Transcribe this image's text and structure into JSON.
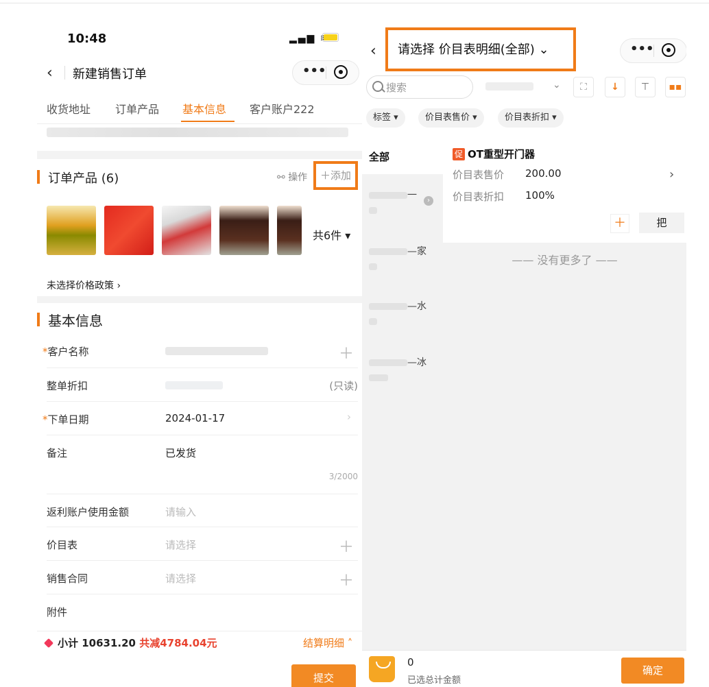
{
  "left": {
    "status": {
      "time": "10:48"
    },
    "nav": {
      "title": "新建销售订单"
    },
    "tabs": [
      "收货地址",
      "订单产品",
      "基本信息",
      "客户账户222"
    ],
    "products": {
      "title": "订单产品 (6)",
      "op_label": "操作",
      "add_label": "添加",
      "count_label": "共6件",
      "policy": "未选择价格政策 ›"
    },
    "basic": {
      "title": "基本信息",
      "fields": {
        "customer": "客户名称",
        "discount": "整单折扣",
        "discount_readonly": "(只读)",
        "date": "下单日期",
        "date_value": "2024-01-17",
        "note": "备注",
        "note_value": "已发货",
        "note_counter": "3/2000",
        "rebate": "返利账户使用金额",
        "rebate_placeholder": "请输入",
        "pricelist": "价目表",
        "pricelist_placeholder": "请选择",
        "contract": "销售合同",
        "contract_placeholder": "请选择",
        "attachment": "附件"
      }
    },
    "bottom": {
      "subtotal": "小计 10631.20",
      "discount_total": "共减4784.04元",
      "settle": "结算明细",
      "submit": "提交"
    }
  },
  "right": {
    "title": "请选择 价目表明细(全部)",
    "search_placeholder": "搜索",
    "chips": [
      "标签",
      "价目表售价",
      "价目表折扣"
    ],
    "sidebar": {
      "all": "全部",
      "items": [
        "一",
        "—家",
        "—水",
        "—冰"
      ]
    },
    "product": {
      "promo": "促",
      "name": "OT重型开门器",
      "price_label": "价目表售价",
      "price_value": "200.00",
      "discount_label": "价目表折扣",
      "discount_value": "100%",
      "action_label": "把"
    },
    "no_more": "没有更多了",
    "bottom": {
      "amount": "0",
      "amount_label": "已选总计金额",
      "confirm": "确定"
    }
  }
}
